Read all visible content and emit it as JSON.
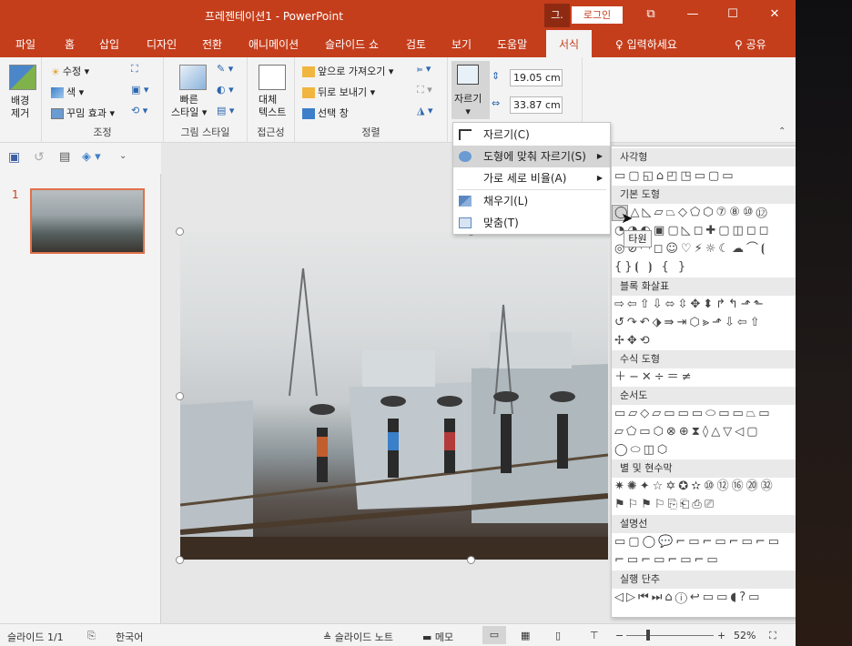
{
  "window": {
    "title": "프레젠테이션1 - PowerPoint",
    "user_badge": "그.",
    "login": "로그인",
    "controls": {
      "restore_ribbon": "⧉",
      "minimize": "—",
      "maximize": "☐",
      "close": "✕"
    }
  },
  "tabs": [
    {
      "label": "파일"
    },
    {
      "label": "홈"
    },
    {
      "label": "삽입"
    },
    {
      "label": "디자인"
    },
    {
      "label": "전환"
    },
    {
      "label": "애니메이션"
    },
    {
      "label": "슬라이드 쇼"
    },
    {
      "label": "검토"
    },
    {
      "label": "보기"
    },
    {
      "label": "도움말"
    },
    {
      "label": "서식"
    }
  ],
  "tell_me": "입력하세요",
  "share": "공유",
  "ribbon": {
    "remove_bg": "배경\n제거",
    "remove_bg_l1": "배경",
    "remove_bg_l2": "제거",
    "corrections": "수정",
    "color": "색",
    "artistic": "꾸밈 효과",
    "group_adjust": "조정",
    "quick_styles_l1": "빠른",
    "quick_styles_l2": "스타일",
    "group_picture_styles": "그림 스타일",
    "alt_text_l1": "대체",
    "alt_text_l2": "텍스트",
    "group_accessibility": "접근성",
    "bring_forward": "앞으로 가져오기",
    "send_backward": "뒤로 보내기",
    "selection_pane": "선택 창",
    "group_arrange": "정렬",
    "crop": "자르기",
    "height": "19.05 cm",
    "width": "33.87 cm"
  },
  "crop_menu": [
    {
      "label": "자르기(C)",
      "icon": "crop-icon"
    },
    {
      "label": "도형에 맞춰 자르기(S)",
      "icon": "crop-shape-icon",
      "submenu": true
    },
    {
      "label": "가로 세로 비율(A)",
      "icon": "",
      "submenu": true
    },
    {
      "label": "채우기(L)",
      "icon": "fill-icon"
    },
    {
      "label": "맞춤(T)",
      "icon": "fit-icon"
    }
  ],
  "shapes_panel": {
    "categories": [
      "사각형",
      "기본 도형",
      "블록 화살표",
      "수식 도형",
      "순서도",
      "별 및 현수막",
      "설명선",
      "실행 단추"
    ],
    "rows": {
      "rect": "▭▢◱⌂◰◳▭▢▭",
      "basic1": "◯△◺▱⏢◇⬠⬡⑦⑧⑩⑫",
      "basic2": "◔◑◐▣▢◺◻✚▢◫◻◻",
      "basic3": "◎⊘◠◻☺♡⚡☼☾☁⌒⦗",
      "basic4": "{}⦗ ⦘ { }",
      "arrows1": "⇨⇦⇧⇩⬄⇳✥⬍↱↰⬏⬑",
      "arrows2": "↺↷↶⬗⇛⇥⬡⪢⬏⇩⇦⇧",
      "arrows3": "✢✥⟲",
      "math": "＋−✕÷＝≠",
      "flow1": "▭▱◇▱▭▭▭⬭▭▭⏢▭",
      "flow2": "▱⬠▭⬡⊗⊕⧗◊△▽◁▢",
      "flow3": "◯⬭◫⬡",
      "stars1": "✷✺✦☆✡✪✫⑩⑫⑯⑳㉜",
      "stars2": "⚑⚐⚑⚐⎘⎗⎙⎚",
      "callouts1": "▭▢◯💬⌐▭⌐▭⌐▭⌐▭",
      "callouts2": "⌐▭⌐▭⌐▭⌐▭",
      "actions": "◁▷⏮⏭⌂ⓘ↩▭▭◖?▭"
    },
    "tooltip": "타원"
  },
  "slide_panel": {
    "number": "1"
  },
  "status": {
    "slide": "슬라이드 1/1",
    "language": "한국어",
    "notes": "슬라이드 노트",
    "comments": "메모",
    "zoom": "52%",
    "zoom_minus": "−",
    "zoom_plus": "+"
  }
}
